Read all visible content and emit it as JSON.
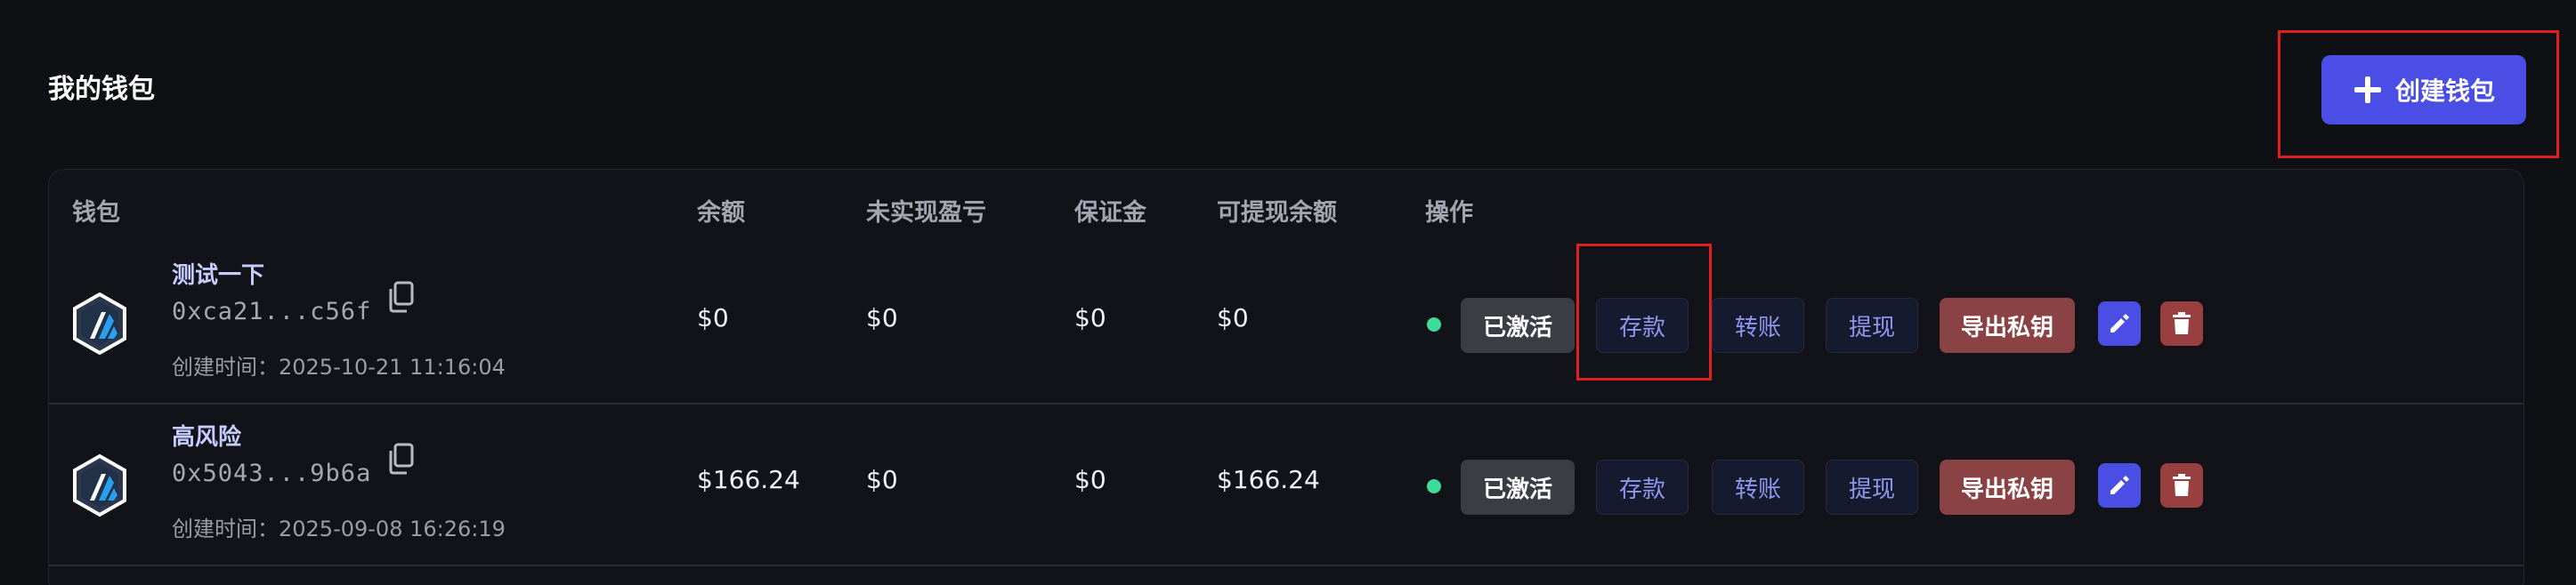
{
  "header": {
    "title": "我的钱包",
    "create_button_label": "创建钱包"
  },
  "table": {
    "columns": [
      "钱包",
      "余额",
      "未实现盈亏",
      "保证金",
      "可提现余额",
      "操作"
    ],
    "rows": [
      {
        "name": "测试一下",
        "address": "0xca21...c56f",
        "created_at": "创建时间：2025-10-21 11:16:04",
        "balance": "$0",
        "unrealized_pnl": "$0",
        "margin": "$0",
        "withdrawable": "$0",
        "status": "已激活",
        "actions": {
          "deposit": "存款",
          "transfer": "转账",
          "withdraw": "提现",
          "export_key": "导出私钥"
        }
      },
      {
        "name": "高风险",
        "address": "0x5043...9b6a",
        "created_at": "创建时间：2025-09-08 16:26:19",
        "balance": "$166.24",
        "unrealized_pnl": "$0",
        "margin": "$0",
        "withdrawable": "$166.24",
        "status": "已激活",
        "actions": {
          "deposit": "存款",
          "transfer": "转账",
          "withdraw": "提现",
          "export_key": "导出私钥"
        }
      }
    ]
  },
  "icons": {
    "create": "plus-icon",
    "chain": "arbitrum-logo-icon",
    "copy": "copy-icon",
    "edit": "pencil-icon",
    "delete": "trash-icon"
  },
  "colors": {
    "background": "#0f1014",
    "accent": "#4b4ee4",
    "danger": "#8b4244",
    "status_active": "#3ddc97",
    "annotation": "#e0201e"
  }
}
